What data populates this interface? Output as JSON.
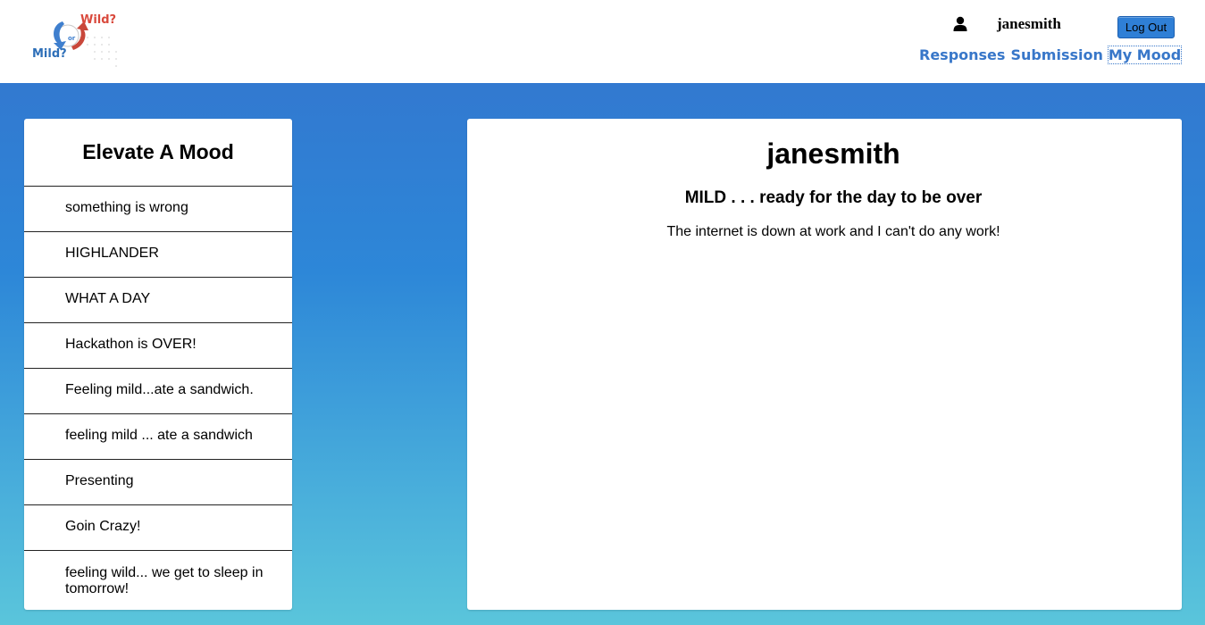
{
  "logo": {
    "wild_text": "Wild?",
    "or_text": "or",
    "mild_text": "Mild?"
  },
  "header": {
    "user_icon": "user-icon",
    "username": "janesmith",
    "logout_label": "Log Out",
    "nav": [
      {
        "label": "Responses",
        "active": false
      },
      {
        "label": "Submission",
        "active": false
      },
      {
        "label": "My Mood",
        "active": true
      }
    ]
  },
  "sidebar": {
    "title": "Elevate A Mood",
    "items": [
      {
        "label": "something is wrong"
      },
      {
        "label": "HIGHLANDER"
      },
      {
        "label": "WHAT A DAY"
      },
      {
        "label": "Hackathon is OVER!"
      },
      {
        "label": "Feeling mild...ate a sandwich."
      },
      {
        "label": "feeling mild ... ate a sandwich"
      },
      {
        "label": "Presenting"
      },
      {
        "label": "Goin Crazy!"
      },
      {
        "label": "feeling wild... we get to sleep in tomorrow!"
      }
    ]
  },
  "main": {
    "username": "janesmith",
    "mood": "MILD . . . ready for the day to be over",
    "description": "The internet is down at work and I can't do any work!"
  },
  "colors": {
    "accent": "#3877c9",
    "button": "#2f7fd6",
    "background_top": "#3279d0",
    "background_bottom": "#5ac5db"
  }
}
